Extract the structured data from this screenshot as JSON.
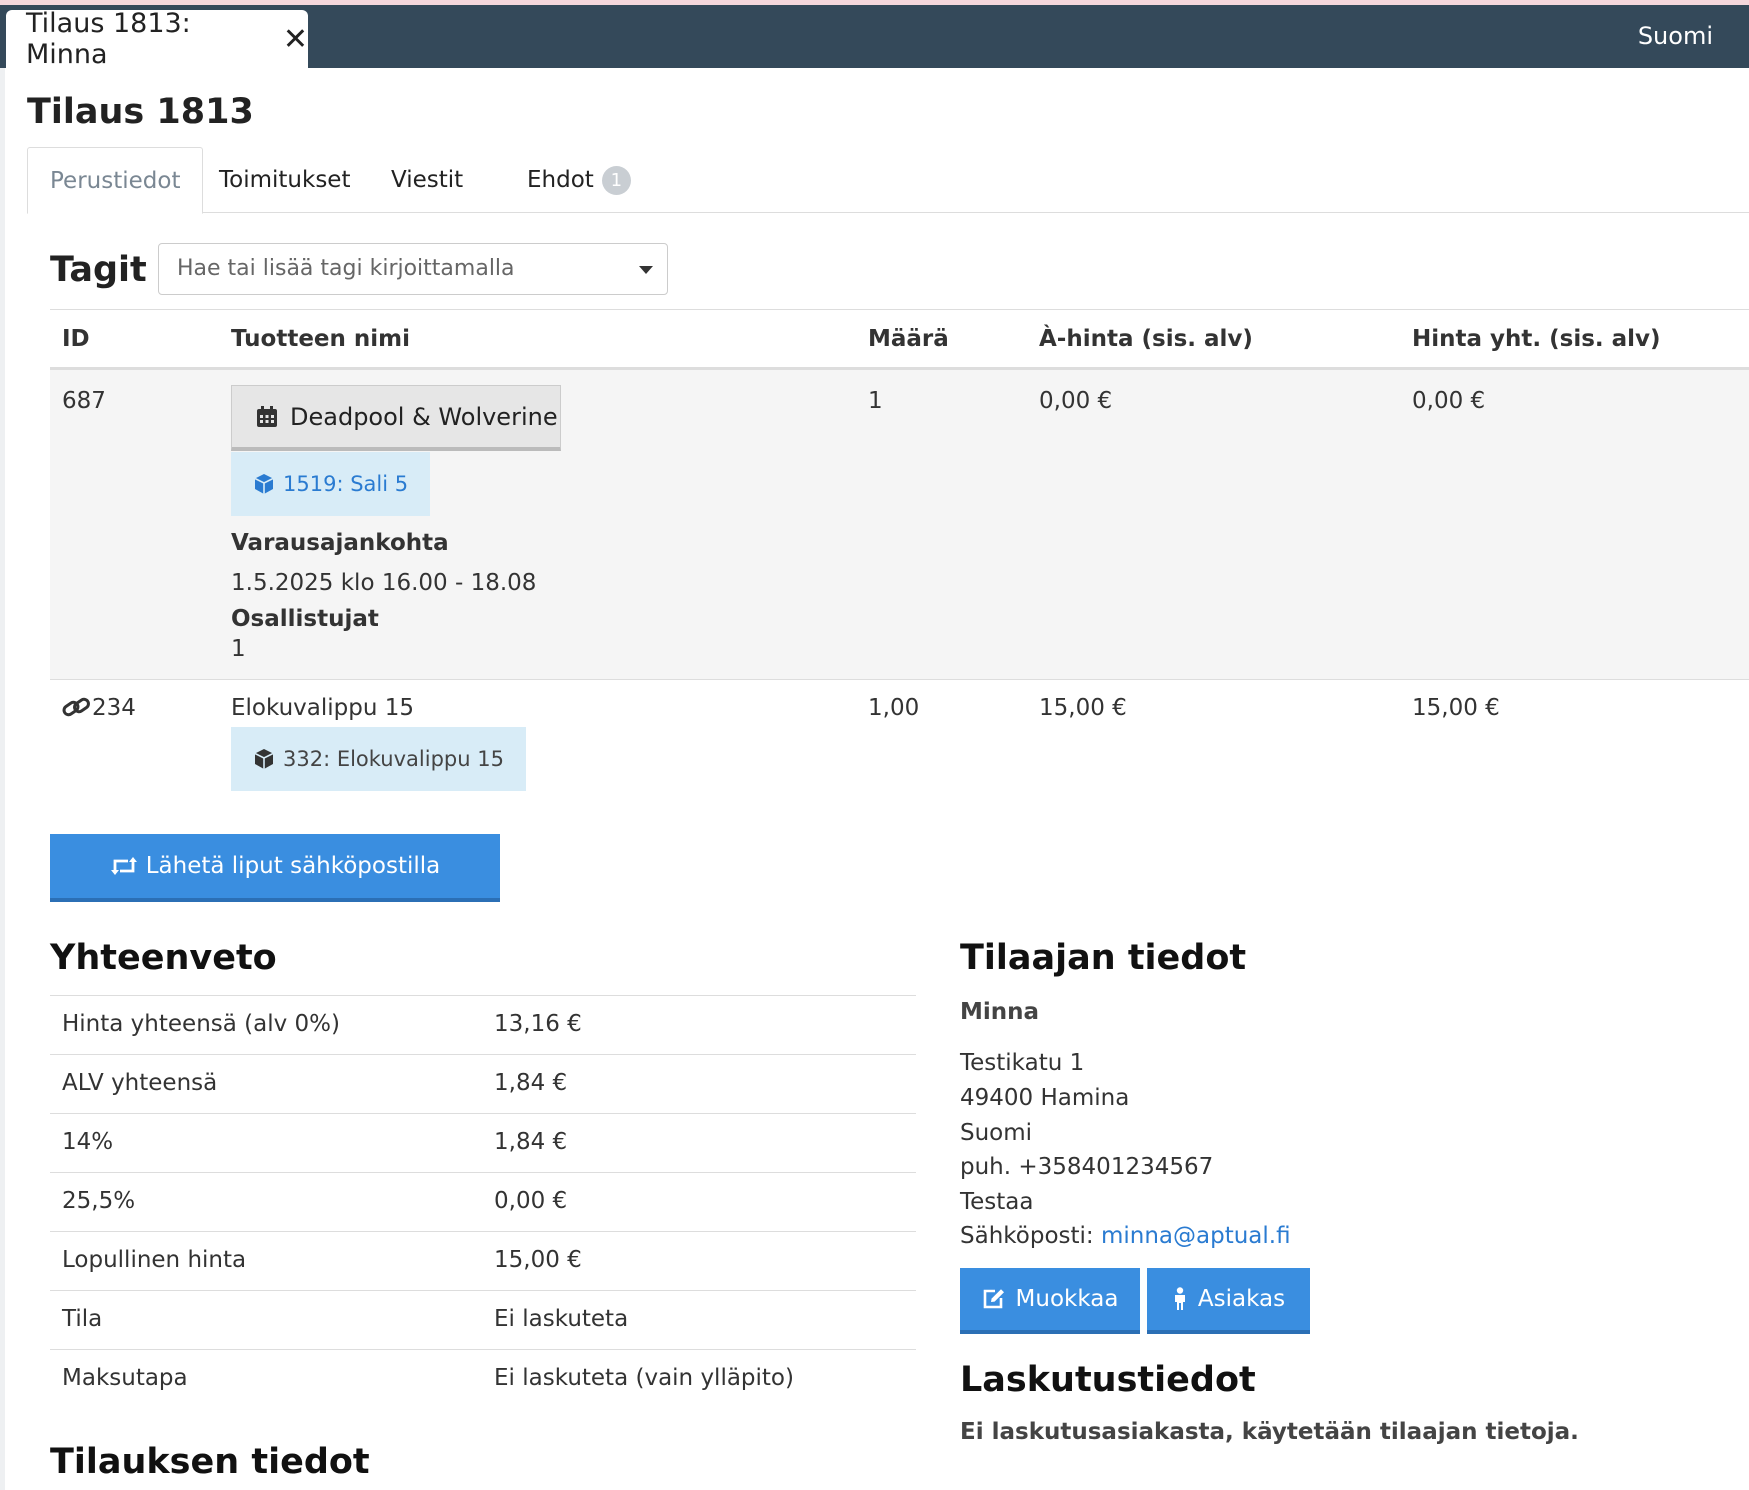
{
  "window": {
    "tab_title": "Tilaus 1813: Minna",
    "language": "Suomi"
  },
  "page": {
    "title": "Tilaus 1813"
  },
  "tabs": [
    {
      "label": "Perustiedot",
      "active": true
    },
    {
      "label": "Toimitukset"
    },
    {
      "label": "Viestit"
    },
    {
      "label": "Ehdot",
      "badge": "1"
    }
  ],
  "tags": {
    "label": "Tagit",
    "placeholder": "Hae tai lisää tagi kirjoittamalla"
  },
  "table": {
    "headers": [
      "ID",
      "Tuotteen nimi",
      "Määrä",
      "À-hinta (sis. alv)",
      "Hinta yht. (sis. alv)"
    ],
    "rows": [
      {
        "id": "687",
        "product": "Deadpool & Wolverine",
        "product_icon": "calendar-icon",
        "sub_item": "1519: Sali 5",
        "sub_icon": "cube-icon",
        "detail1_label": "Varausajankohta",
        "detail1_value": "1.5.2025 klo 16.00 - 18.08",
        "detail2_label": "Osallistujat",
        "detail2_value": "1",
        "quantity": "1",
        "unit_price": "0,00 €",
        "total": "0,00 €"
      },
      {
        "id": "234",
        "id_icon": "link-icon",
        "product": "Elokuvalippu 15",
        "sub_item": "332: Elokuvalippu 15",
        "sub_icon": "cube-icon",
        "quantity": "1,00",
        "unit_price": "15,00 €",
        "total": "15,00 €"
      }
    ]
  },
  "send_button": {
    "label": "Lähetä liput sähköpostilla",
    "icon": "retweet-icon"
  },
  "summary": {
    "title": "Yhteenveto",
    "rows": [
      {
        "label": "Hinta yhteensä (alv 0%)",
        "value": "13,16 €"
      },
      {
        "label": "ALV yhteensä",
        "value": "1,84 €"
      },
      {
        "label": "14%",
        "value": "1,84 €"
      },
      {
        "label": "25,5%",
        "value": "0,00 €"
      },
      {
        "label": "Lopullinen hinta",
        "value": "15,00 €"
      },
      {
        "label": "Tila",
        "value": "Ei laskuteta"
      },
      {
        "label": "Maksutapa",
        "value": "Ei laskuteta (vain ylläpito)"
      }
    ]
  },
  "order_details": {
    "title": "Tilauksen tiedot"
  },
  "customer": {
    "title": "Tilaajan tiedot",
    "name": "Minna",
    "address1": "Testikatu 1",
    "address2": "49400 Hamina",
    "country": "Suomi",
    "phone": "puh. +358401234567",
    "note": "Testaa",
    "email_label": "Sähköposti:",
    "email": "minna@aptual.fi",
    "edit_button": "Muokkaa",
    "customer_button": "Asiakas"
  },
  "billing": {
    "title": "Laskutustiedot",
    "text": "Ei laskutusasiakasta, käytetään tilaajan tietoja."
  }
}
